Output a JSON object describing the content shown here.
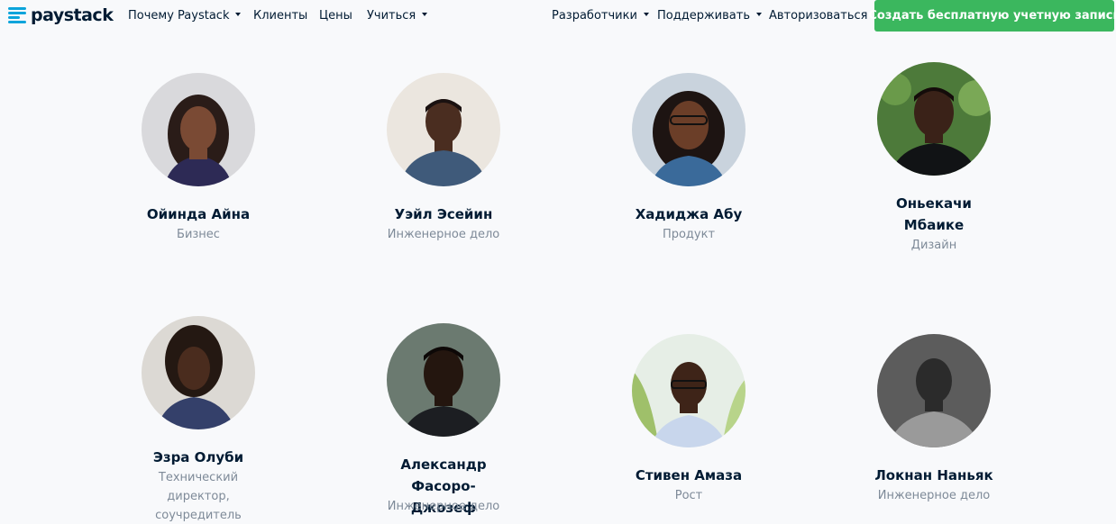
{
  "brand": {
    "name": "paystack",
    "accent": "#0ba4db",
    "cta_color": "#3bb75e"
  },
  "nav": {
    "left": [
      {
        "label": "Почему Paystack",
        "dropdown": true
      },
      {
        "label": "Клиенты",
        "dropdown": false
      },
      {
        "label": "Цены",
        "dropdown": false
      },
      {
        "label": "Учиться",
        "dropdown": true
      }
    ],
    "right": [
      {
        "label": "Разработчики",
        "dropdown": true
      },
      {
        "label": "Поддерживать",
        "dropdown": true
      },
      {
        "label": "Авторизоваться",
        "dropdown": false
      }
    ],
    "cta_label": "Создать бесплатную учетную запись"
  },
  "team": [
    {
      "name": "Ойинда Айна",
      "role": "Бизнес"
    },
    {
      "name": "Уэйл Эсейин",
      "role": "Инженерное дело"
    },
    {
      "name": "Хадиджа Абу",
      "role": "Продукт"
    },
    {
      "name": "Оньекачи Мбаике",
      "role": "Дизайн"
    },
    {
      "name": "Эзра Олуби",
      "role": "Технический директор, соучредитель"
    },
    {
      "name": "Александр Фасоро-Джозеф",
      "role": "Инженерное дело"
    },
    {
      "name": "Стивен Амаза",
      "role": "Рост"
    },
    {
      "name": "Локнан Наньяк",
      "role": "Инженерное дело"
    }
  ]
}
